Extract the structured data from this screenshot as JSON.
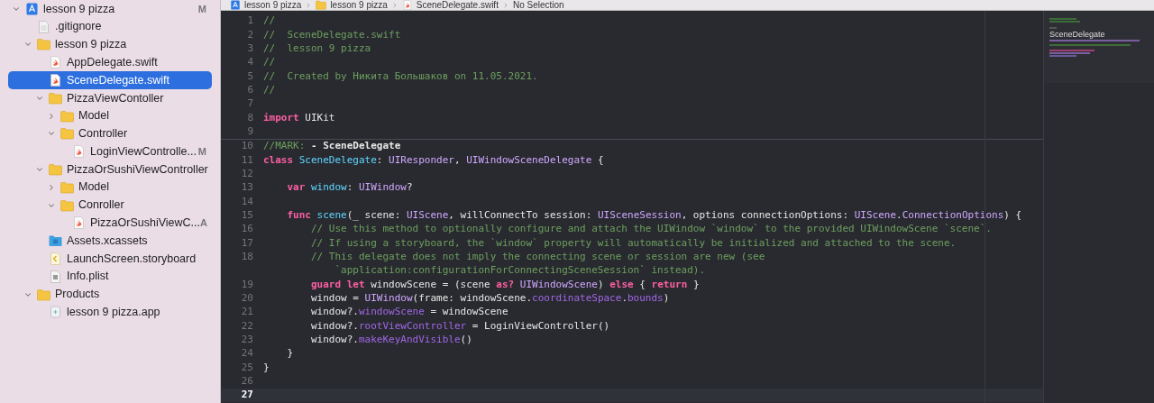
{
  "navigator": {
    "items": [
      {
        "label": "lesson 9 pizza",
        "kind": "project",
        "badge": "M",
        "selected": false,
        "expanded": true,
        "children": [
          {
            "label": ".gitignore",
            "kind": "file",
            "selected": false
          },
          {
            "label": "lesson 9 pizza",
            "kind": "folder",
            "selected": false,
            "expanded": true,
            "children": [
              {
                "label": "AppDelegate.swift",
                "kind": "swift",
                "selected": false
              },
              {
                "label": "SceneDelegate.swift",
                "kind": "swift",
                "selected": true
              },
              {
                "label": "PizzaViewContoller",
                "kind": "folder",
                "selected": false,
                "expanded": true,
                "children": [
                  {
                    "label": "Model",
                    "kind": "folder",
                    "selected": false,
                    "expanded": false
                  },
                  {
                    "label": "Controller",
                    "kind": "folder",
                    "selected": false,
                    "expanded": true,
                    "children": [
                      {
                        "label": "LoginViewControlle...",
                        "kind": "swift",
                        "badge": "M",
                        "selected": false
                      }
                    ]
                  }
                ]
              },
              {
                "label": "PizzaOrSushiViewController",
                "kind": "folder",
                "selected": false,
                "expanded": true,
                "children": [
                  {
                    "label": "Model",
                    "kind": "folder",
                    "selected": false,
                    "expanded": false
                  },
                  {
                    "label": "Conroller",
                    "kind": "folder",
                    "selected": false,
                    "expanded": true,
                    "children": [
                      {
                        "label": "PizzaOrSushiViewC...",
                        "kind": "swift",
                        "badge": "A",
                        "selected": false
                      }
                    ]
                  }
                ]
              },
              {
                "label": "Assets.xcassets",
                "kind": "assets",
                "selected": false
              },
              {
                "label": "LaunchScreen.storyboard",
                "kind": "storyboard",
                "selected": false
              },
              {
                "label": "Info.plist",
                "kind": "plist",
                "selected": false
              }
            ]
          },
          {
            "label": "Products",
            "kind": "folder",
            "selected": false,
            "expanded": true,
            "children": [
              {
                "label": "lesson 9 pizza.app",
                "kind": "app",
                "selected": false
              }
            ]
          }
        ]
      }
    ]
  },
  "breadcrumb": [
    {
      "label": "lesson 9 pizza",
      "kind": "project"
    },
    {
      "label": "lesson 9 pizza",
      "kind": "folder"
    },
    {
      "label": "SceneDelegate.swift",
      "kind": "swift"
    },
    {
      "label": "No Selection",
      "kind": "plain"
    }
  ],
  "editor": {
    "lines": [
      {
        "number": "1",
        "current": false,
        "mark": false,
        "segments": [
          {
            "kind": "comment",
            "text": "//"
          }
        ]
      },
      {
        "number": "2",
        "current": false,
        "mark": false,
        "segments": [
          {
            "kind": "comment",
            "text": "//  SceneDelegate.swift"
          }
        ]
      },
      {
        "number": "3",
        "current": false,
        "mark": false,
        "segments": [
          {
            "kind": "comment",
            "text": "//  lesson 9 pizza"
          }
        ]
      },
      {
        "number": "4",
        "current": false,
        "mark": false,
        "segments": [
          {
            "kind": "comment",
            "text": "//"
          }
        ]
      },
      {
        "number": "5",
        "current": false,
        "mark": false,
        "segments": [
          {
            "kind": "comment",
            "text": "//  Created by Никита Большаков on 11.05.2021."
          }
        ]
      },
      {
        "number": "6",
        "current": false,
        "mark": false,
        "segments": [
          {
            "kind": "comment",
            "text": "//"
          }
        ]
      },
      {
        "number": "7",
        "current": false,
        "mark": false
      },
      {
        "number": "8",
        "current": false,
        "mark": false,
        "segments": [
          {
            "kind": "keyword",
            "text": "import"
          },
          {
            "kind": "plain",
            "text": " UIKit"
          }
        ]
      },
      {
        "number": "9",
        "current": false,
        "mark": false
      },
      {
        "number": "10",
        "current": false,
        "mark": true,
        "segments": [
          {
            "kind": "comment",
            "text": "//MARK: "
          },
          {
            "kind": "mark",
            "text": "- SceneDelegate"
          }
        ]
      },
      {
        "number": "11",
        "current": false,
        "mark": false,
        "segments": [
          {
            "kind": "keyword",
            "text": "class "
          },
          {
            "kind": "decl",
            "text": "SceneDelegate"
          },
          {
            "kind": "plain",
            "text": ": "
          },
          {
            "kind": "type",
            "text": "UIResponder"
          },
          {
            "kind": "plain",
            "text": ", "
          },
          {
            "kind": "type",
            "text": "UIWindowSceneDelegate"
          },
          {
            "kind": "plain",
            "text": " {"
          }
        ]
      },
      {
        "number": "12",
        "current": false,
        "mark": false
      },
      {
        "number": "13",
        "current": false,
        "mark": false,
        "segments": [
          {
            "kind": "keyword",
            "text": "    var "
          },
          {
            "kind": "decl",
            "text": "window"
          },
          {
            "kind": "plain",
            "text": ": "
          },
          {
            "kind": "type",
            "text": "UIWindow"
          },
          {
            "kind": "plain",
            "text": "?"
          }
        ]
      },
      {
        "number": "14",
        "current": false,
        "mark": false
      },
      {
        "number": "15",
        "current": false,
        "mark": false,
        "segments": [
          {
            "kind": "keyword",
            "text": "    func "
          },
          {
            "kind": "decl",
            "text": "scene"
          },
          {
            "kind": "plain",
            "text": "(_ scene: "
          },
          {
            "kind": "type",
            "text": "UIScene"
          },
          {
            "kind": "plain",
            "text": ", willConnectTo session: "
          },
          {
            "kind": "type",
            "text": "UISceneSession"
          },
          {
            "kind": "plain",
            "text": ", options connectionOptions: "
          },
          {
            "kind": "type",
            "text": "UIScene"
          },
          {
            "kind": "plain",
            "text": "."
          },
          {
            "kind": "type",
            "text": "ConnectionOptions"
          },
          {
            "kind": "plain",
            "text": ") {"
          }
        ]
      },
      {
        "number": "16",
        "current": false,
        "mark": false,
        "segments": [
          {
            "kind": "comment",
            "text": "        // Use this method to optionally configure and attach the UIWindow `window` to the provided UIWindowScene `scene`."
          }
        ]
      },
      {
        "number": "17",
        "current": false,
        "mark": false,
        "segments": [
          {
            "kind": "comment",
            "text": "        // If using a storyboard, the `window` property will automatically be initialized and attached to the scene."
          }
        ]
      },
      {
        "number": "18",
        "current": false,
        "mark": false,
        "segments": [
          {
            "kind": "comment",
            "text": "        // This delegate does not imply the connecting scene or session are new (see"
          }
        ],
        "continuation": [
          {
            "kind": "comment",
            "text": "            `application:configurationForConnectingSceneSession` instead)."
          }
        ]
      },
      {
        "number": "19",
        "current": false,
        "mark": false,
        "segments": [
          {
            "kind": "keyword",
            "text": "        guard let"
          },
          {
            "kind": "plain",
            "text": " windowScene = (scene "
          },
          {
            "kind": "keyword",
            "text": "as? "
          },
          {
            "kind": "type",
            "text": "UIWindowScene"
          },
          {
            "kind": "plain",
            "text": ") "
          },
          {
            "kind": "keyword",
            "text": "else"
          },
          {
            "kind": "plain",
            "text": " { "
          },
          {
            "kind": "keyword",
            "text": "return"
          },
          {
            "kind": "plain",
            "text": " }"
          }
        ]
      },
      {
        "number": "20",
        "current": false,
        "mark": false,
        "segments": [
          {
            "kind": "plain",
            "text": "        window = "
          },
          {
            "kind": "type",
            "text": "UIWindow"
          },
          {
            "kind": "plain",
            "text": "(frame: windowScene."
          },
          {
            "kind": "property",
            "text": "coordinateSpace"
          },
          {
            "kind": "plain",
            "text": "."
          },
          {
            "kind": "property",
            "text": "bounds"
          },
          {
            "kind": "plain",
            "text": ")"
          }
        ]
      },
      {
        "number": "21",
        "current": false,
        "mark": false,
        "segments": [
          {
            "kind": "plain",
            "text": "        window?."
          },
          {
            "kind": "property",
            "text": "windowScene"
          },
          {
            "kind": "plain",
            "text": " = windowScene"
          }
        ]
      },
      {
        "number": "22",
        "current": false,
        "mark": false,
        "segments": [
          {
            "kind": "plain",
            "text": "        window?."
          },
          {
            "kind": "property",
            "text": "rootViewController"
          },
          {
            "kind": "plain",
            "text": " = LoginViewController()"
          }
        ]
      },
      {
        "number": "23",
        "current": false,
        "mark": false,
        "segments": [
          {
            "kind": "plain",
            "text": "        window?."
          },
          {
            "kind": "property",
            "text": "makeKeyAndVisible"
          },
          {
            "kind": "plain",
            "text": "()"
          }
        ]
      },
      {
        "number": "24",
        "current": false,
        "mark": false,
        "segments": [
          {
            "kind": "plain",
            "text": "    }"
          }
        ]
      },
      {
        "number": "25",
        "current": false,
        "mark": false,
        "segments": [
          {
            "kind": "plain",
            "text": "}"
          }
        ]
      },
      {
        "number": "26",
        "current": false,
        "mark": false
      },
      {
        "number": "27",
        "current": true,
        "mark": false
      }
    ]
  },
  "minimap": {
    "mark_title": "SceneDelegate"
  }
}
